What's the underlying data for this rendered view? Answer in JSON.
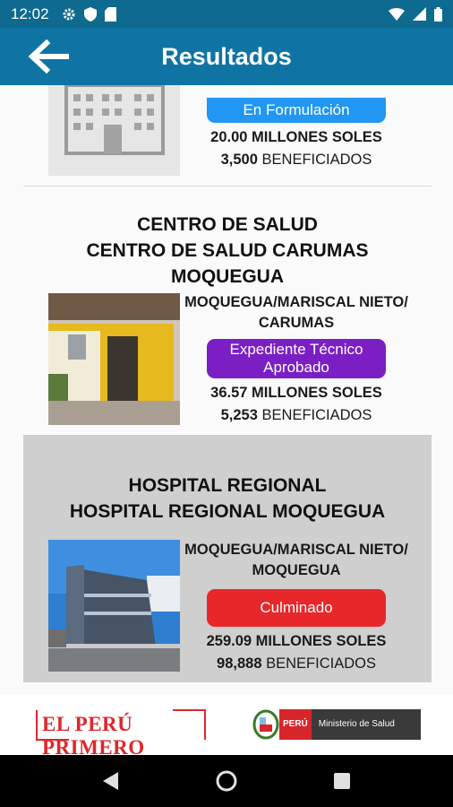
{
  "status_bar": {
    "time": "12:02"
  },
  "app_bar": {
    "title": "Resultados"
  },
  "results": [
    {
      "status": "En Formulación",
      "status_color": "#2196f3",
      "amount": "20.00 MILLONES SOLES",
      "beneficiaries_count": "3,500",
      "beneficiaries_label": "BENEFICIADOS"
    },
    {
      "name_line1": "CENTRO DE SALUD",
      "name_line2": "CENTRO DE SALUD CARUMAS",
      "name_line3": "MOQUEGUA",
      "location_line1": "MOQUEGUA/MARISCAL NIETO/",
      "location_line2": "CARUMAS",
      "status": "Expediente Técnico Aprobado",
      "status_color": "#7b1fc4",
      "amount": "36.57 MILLONES SOLES",
      "beneficiaries_count": "5,253",
      "beneficiaries_label": "BENEFICIADOS"
    },
    {
      "name_line1": "HOSPITAL REGIONAL",
      "name_line2": "HOSPITAL REGIONAL MOQUEGUA",
      "location_line1": "MOQUEGUA/MARISCAL NIETO/",
      "location_line2": "MOQUEGUA",
      "status": "Culminado",
      "status_color": "#e8272a",
      "amount": "259.09 MILLONES SOLES",
      "beneficiaries_count": "98,888",
      "beneficiaries_label": "BENEFICIADOS"
    }
  ],
  "footer": {
    "logo_text": "EL PERÚ PRIMERO",
    "peru_label": "PERÚ",
    "ministry_label": "Ministerio de Salud"
  },
  "colors": {
    "app_bar": "#0f74a3",
    "status_bar": "#0e6a8e",
    "selected_card_bg": "#cfcfcf"
  }
}
